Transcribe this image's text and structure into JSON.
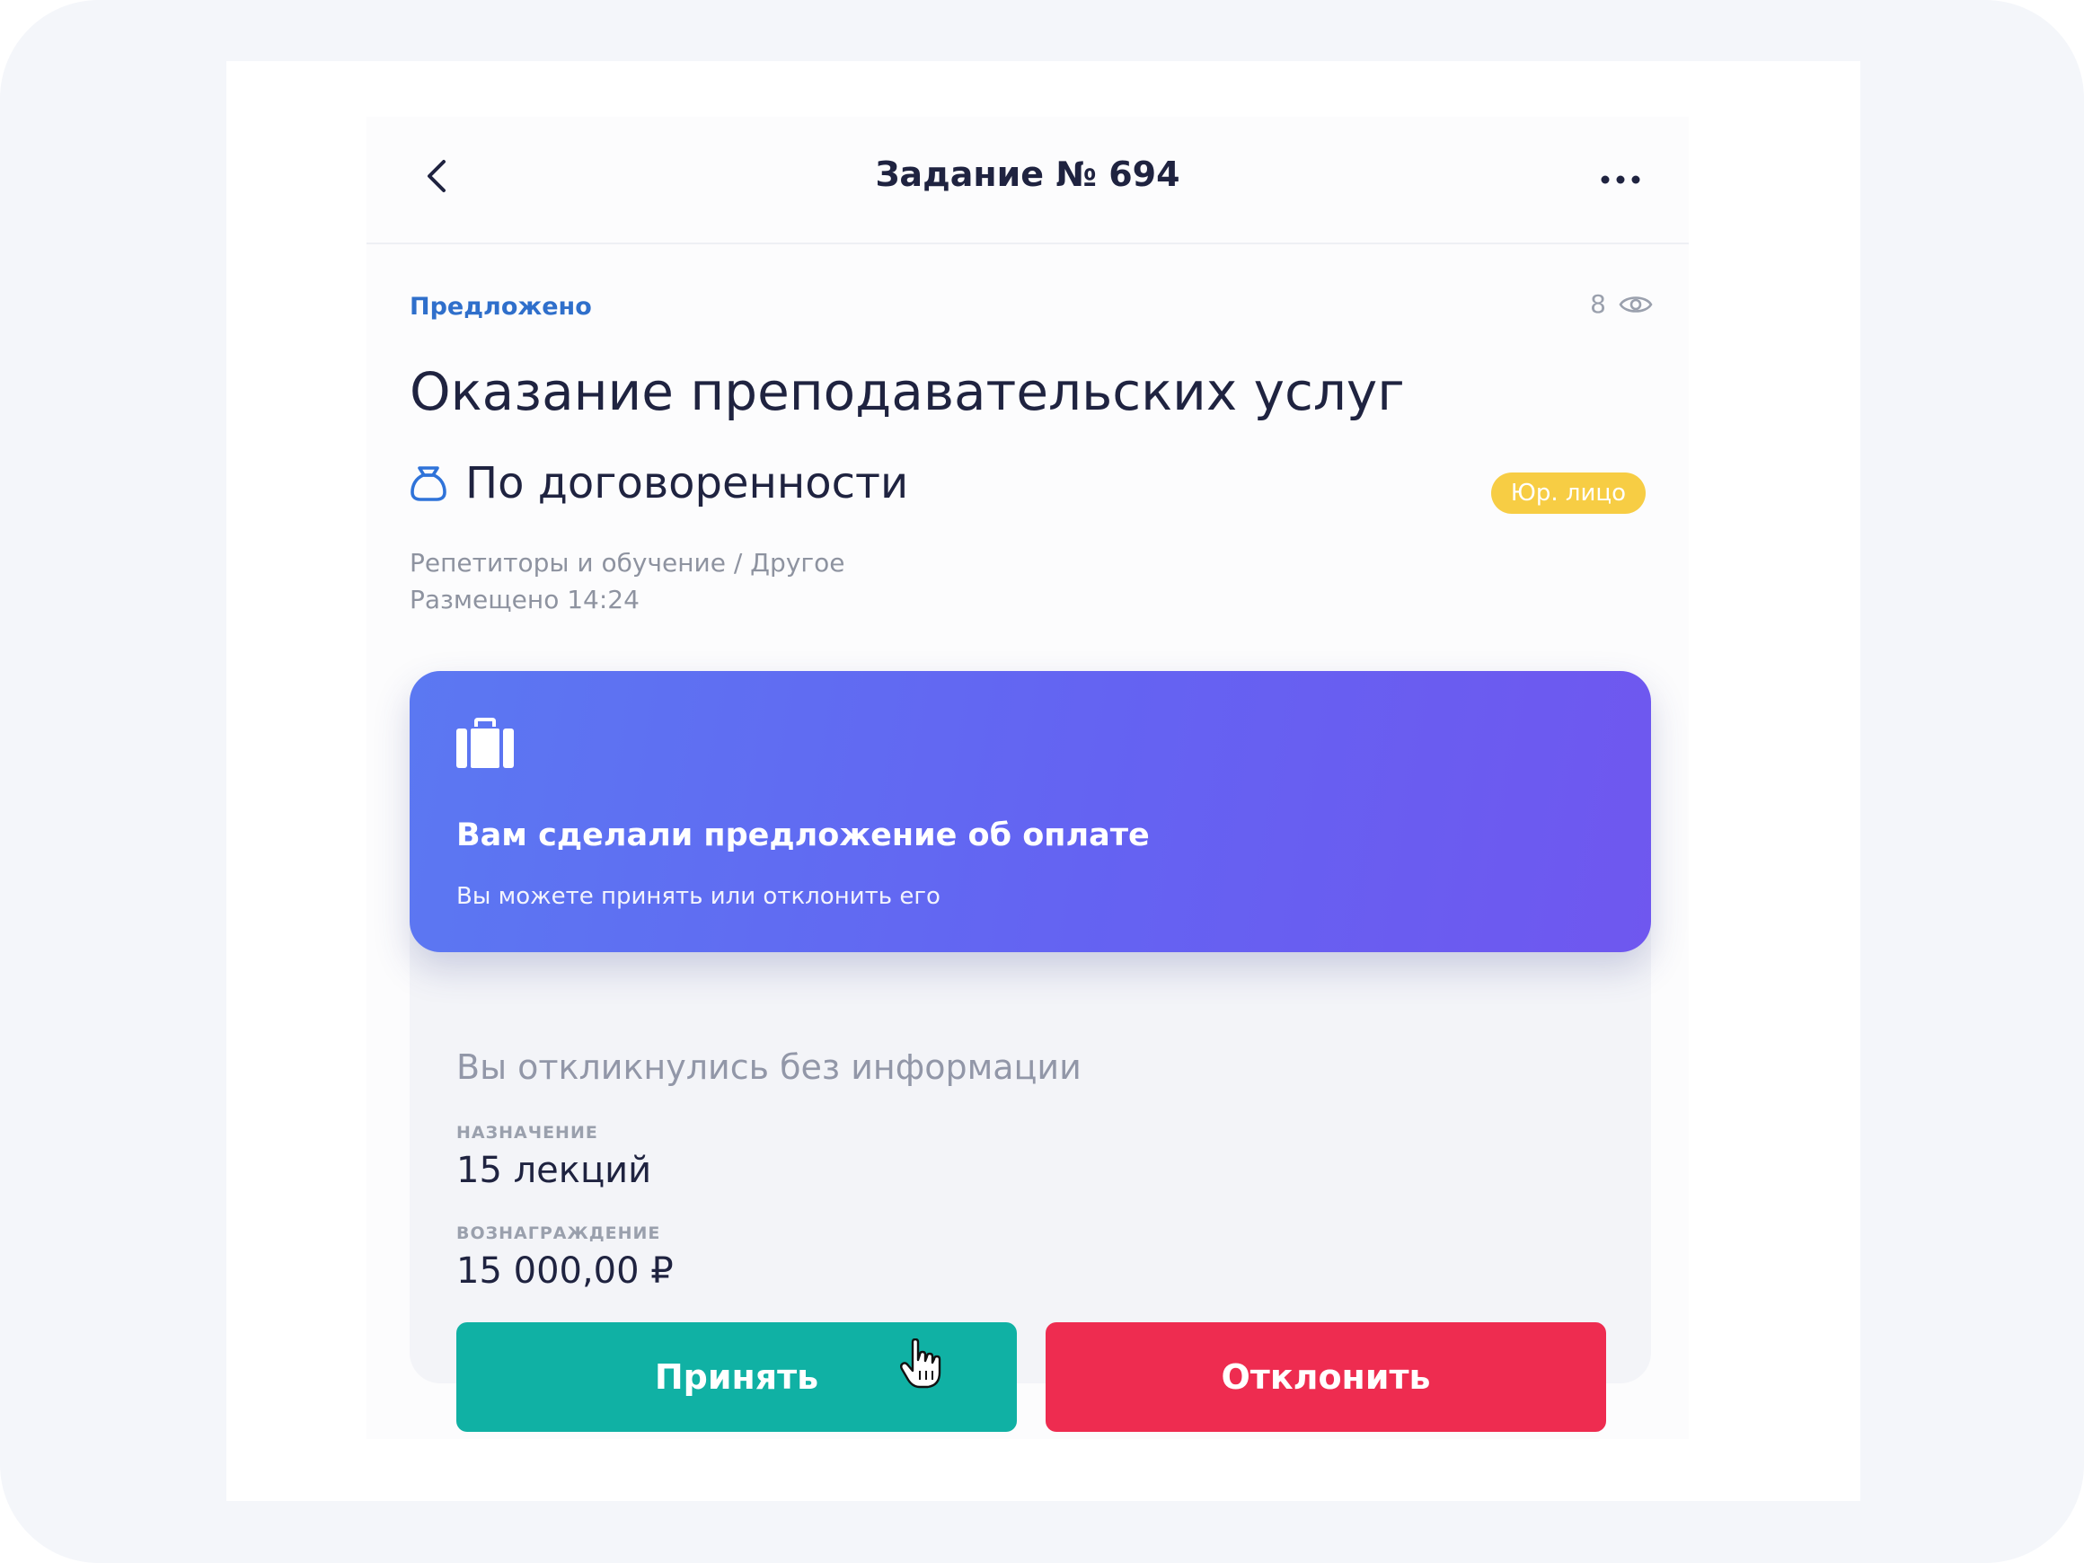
{
  "navbar": {
    "title": "Задание № 694",
    "back_icon": "chevron-left-icon",
    "more_icon": "more-horizontal-icon"
  },
  "task": {
    "status": "Предложено",
    "views": "8",
    "title": "Оказание преподавательских услуг",
    "price": "По договоренности",
    "badge": "Юр. лицо",
    "category": "Репетиторы и обучение / Другое",
    "posted": "Размещено 14:24"
  },
  "offer": {
    "title": "Вам сделали предложение об оплате",
    "subtitle": "Вы можете принять или отклонить его",
    "responded": "Вы откликнулись без информации",
    "purpose_label": "НАЗНАЧЕНИЕ",
    "purpose_value": "15 лекций",
    "reward_label": "ВОЗНАГРАЖДЕНИЕ",
    "reward_value": "15 000,00 ₽",
    "accept_label": "Принять",
    "reject_label": "Отклонить"
  },
  "colors": {
    "status": "#2f6fcb",
    "badge": "#f7cd44",
    "accept": "#10b1a4",
    "reject": "#ee2c50",
    "card_gradient_start": "#5b78f2",
    "card_gradient_end": "#6f57ef"
  }
}
